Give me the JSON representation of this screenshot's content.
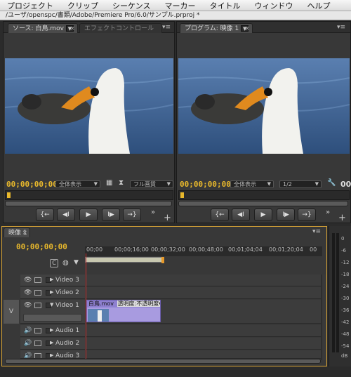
{
  "menu": [
    "プロジェクト",
    "クリップ",
    "シーケンス",
    "マーカー",
    "タイトル",
    "ウィンドウ",
    "ヘルプ"
  ],
  "path": "/ユーザ/openspc/書類/Adobe/Premiere Pro/6.0/サンプル.prproj *",
  "source": {
    "tab": "ソース: 白鳥.mov",
    "tab2": "エフェクトコントロール",
    "timecode": "00;00;00;00",
    "zoom": "全体表示",
    "quality": "フル画質"
  },
  "program": {
    "tab": "プログラム: 映像 1",
    "timecode": "00;00;00;00",
    "zoom": "全体表示",
    "res": "1/2",
    "right_tc": "00"
  },
  "transport": {
    "mark_in": "{←",
    "step_back": "◀I",
    "play": "▶",
    "step_fwd": "I▶",
    "mark_out": "→}",
    "more": "»",
    "add": "+"
  },
  "timeline": {
    "tab": "映像 1",
    "timecode": "00;00;00;00",
    "ticks": [
      "00;00",
      "00;00;16;00",
      "00;00;32;00",
      "00;00;48;00",
      "00;01;04;04",
      "00;01;20;04",
      "00"
    ],
    "tracks": [
      {
        "label": "Video 3",
        "kind": "video"
      },
      {
        "label": "Video 2",
        "kind": "video"
      },
      {
        "label": "Video 1",
        "kind": "video",
        "target": "V"
      },
      {
        "label": "Audio 1",
        "kind": "audio"
      },
      {
        "label": "Audio 2",
        "kind": "audio"
      },
      {
        "label": "Audio 3",
        "kind": "audio"
      }
    ],
    "clip": {
      "name": "白鳥.mov",
      "effect": "透明度:不透明度▾"
    }
  },
  "meter": {
    "labels": [
      "0",
      "-6",
      "-12",
      "-18",
      "-24",
      "-30",
      "-36",
      "-42",
      "-48",
      "-54",
      "dB"
    ]
  },
  "colors": {
    "accent": "#e8b82c",
    "clip": "#a89be0",
    "playhead": "#c63030"
  }
}
